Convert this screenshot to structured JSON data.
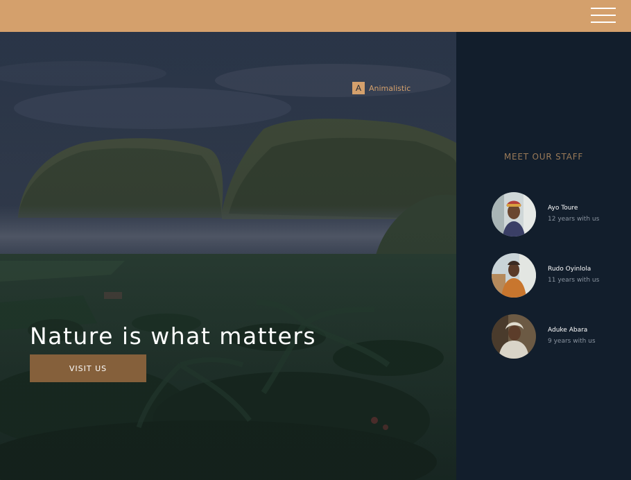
{
  "header": {
    "menu_icon": "hamburger-menu-icon",
    "background_color": "#d4a06c"
  },
  "hero": {
    "brand_letter": "A",
    "brand_name": "Animalistic",
    "headline": "Nature is what matters",
    "cta_label": "VISIT US",
    "accent_color": "#d4a06c",
    "button_color": "#85603b"
  },
  "staff": {
    "title": "MEET OUR STAFF",
    "members": [
      {
        "name": "Ayo Toure",
        "tenure": "12 years with us"
      },
      {
        "name": "Rudo Oyinlola",
        "tenure": "11 years with us"
      },
      {
        "name": "Aduke Abara",
        "tenure": "9 years with us"
      }
    ],
    "panel_color": "#121e2c"
  }
}
